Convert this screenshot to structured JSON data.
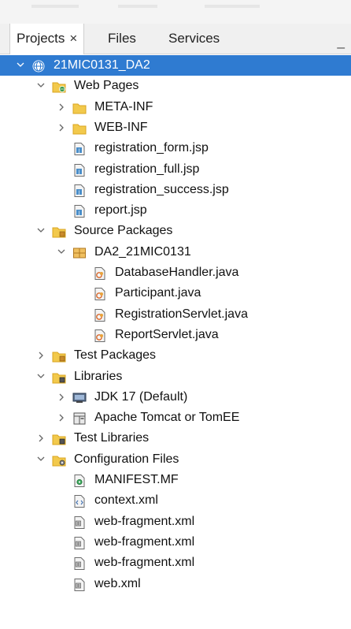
{
  "tabs": [
    {
      "label": "Projects",
      "active": true
    },
    {
      "label": "Files",
      "active": false
    },
    {
      "label": "Services",
      "active": false
    }
  ],
  "tab_close": "×",
  "minimize_glyph": "_",
  "tree": [
    {
      "label": "21MIC0131_DA2",
      "depth": 0,
      "icon": "globe-project-icon",
      "toggle": "expanded",
      "selected": true
    },
    {
      "label": "Web Pages",
      "depth": 1,
      "icon": "web-folder-icon",
      "toggle": "expanded"
    },
    {
      "label": "META-INF",
      "depth": 2,
      "icon": "folder-icon",
      "toggle": "collapsed"
    },
    {
      "label": "WEB-INF",
      "depth": 2,
      "icon": "folder-icon",
      "toggle": "collapsed"
    },
    {
      "label": "registration_form.jsp",
      "depth": 2,
      "icon": "jsp-file-icon",
      "toggle": "none"
    },
    {
      "label": "registration_full.jsp",
      "depth": 2,
      "icon": "jsp-file-icon",
      "toggle": "none"
    },
    {
      "label": "registration_success.jsp",
      "depth": 2,
      "icon": "jsp-file-icon",
      "toggle": "none"
    },
    {
      "label": "report.jsp",
      "depth": 2,
      "icon": "jsp-file-icon",
      "toggle": "none"
    },
    {
      "label": "Source Packages",
      "depth": 1,
      "icon": "source-folder-icon",
      "toggle": "expanded"
    },
    {
      "label": "DA2_21MIC0131",
      "depth": 2,
      "icon": "package-icon",
      "toggle": "expanded"
    },
    {
      "label": "DatabaseHandler.java",
      "depth": 3,
      "icon": "java-file-icon",
      "toggle": "none"
    },
    {
      "label": "Participant.java",
      "depth": 3,
      "icon": "java-file-icon",
      "toggle": "none"
    },
    {
      "label": "RegistrationServlet.java",
      "depth": 3,
      "icon": "java-file-icon",
      "toggle": "none"
    },
    {
      "label": "ReportServlet.java",
      "depth": 3,
      "icon": "java-file-icon",
      "toggle": "none"
    },
    {
      "label": "Test Packages",
      "depth": 1,
      "icon": "source-folder-icon",
      "toggle": "collapsed"
    },
    {
      "label": "Libraries",
      "depth": 1,
      "icon": "library-folder-icon",
      "toggle": "expanded"
    },
    {
      "label": "JDK 17 (Default)",
      "depth": 2,
      "icon": "jdk-icon",
      "toggle": "collapsed"
    },
    {
      "label": "Apache Tomcat or TomEE",
      "depth": 2,
      "icon": "server-library-icon",
      "toggle": "collapsed"
    },
    {
      "label": "Test Libraries",
      "depth": 1,
      "icon": "library-folder-icon",
      "toggle": "collapsed"
    },
    {
      "label": "Configuration Files",
      "depth": 1,
      "icon": "config-folder-icon",
      "toggle": "expanded"
    },
    {
      "label": "MANIFEST.MF",
      "depth": 2,
      "icon": "manifest-file-icon",
      "toggle": "none"
    },
    {
      "label": "context.xml",
      "depth": 2,
      "icon": "context-xml-icon",
      "toggle": "none"
    },
    {
      "label": "web-fragment.xml",
      "depth": 2,
      "icon": "xml-file-icon",
      "toggle": "none"
    },
    {
      "label": "web-fragment.xml",
      "depth": 2,
      "icon": "xml-file-icon",
      "toggle": "none"
    },
    {
      "label": "web-fragment.xml",
      "depth": 2,
      "icon": "xml-file-icon",
      "toggle": "none"
    },
    {
      "label": "web.xml",
      "depth": 2,
      "icon": "xml-file-icon",
      "toggle": "none"
    }
  ],
  "colors": {
    "selection": "#2f7bd1",
    "folder": "#f2c94c",
    "folder_dark": "#d9a521",
    "text": "#111111"
  }
}
